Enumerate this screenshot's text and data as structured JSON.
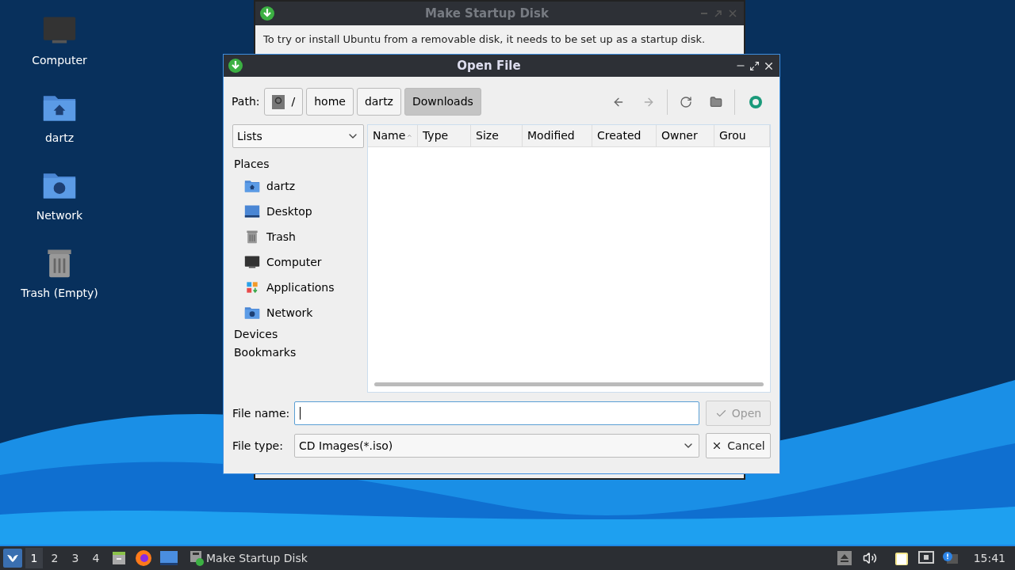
{
  "desktop_icons": [
    {
      "label": "Computer",
      "kind": "computer"
    },
    {
      "label": "dartz",
      "kind": "home"
    },
    {
      "label": "Network",
      "kind": "network"
    },
    {
      "label": "Trash (Empty)",
      "kind": "trash"
    }
  ],
  "background_window": {
    "title": "Make Startup Disk",
    "text": "To try or install Ubuntu from a removable disk, it needs to be set up as a startup disk."
  },
  "dialog": {
    "title": "Open File",
    "path_label": "Path:",
    "path_buttons": [
      {
        "label": "/",
        "kind": "root",
        "selected": false
      },
      {
        "label": "home",
        "kind": "dir",
        "selected": false
      },
      {
        "label": "dartz",
        "kind": "dir",
        "selected": false
      },
      {
        "label": "Downloads",
        "kind": "dir",
        "selected": true
      }
    ],
    "view_select": "Lists",
    "sections": [
      {
        "label": "Places",
        "items": [
          {
            "label": "dartz",
            "kind": "home"
          },
          {
            "label": "Desktop",
            "kind": "desktop"
          },
          {
            "label": "Trash",
            "kind": "trash"
          },
          {
            "label": "Computer",
            "kind": "computer"
          },
          {
            "label": "Applications",
            "kind": "apps"
          },
          {
            "label": "Network",
            "kind": "network"
          }
        ]
      },
      {
        "label": "Devices"
      },
      {
        "label": "Bookmarks"
      }
    ],
    "columns": [
      {
        "label": "Name",
        "sorted": true
      },
      {
        "label": "Type",
        "sorted": false
      },
      {
        "label": "Size",
        "sorted": false
      },
      {
        "label": "Modified",
        "sorted": false
      },
      {
        "label": "Created",
        "sorted": false
      },
      {
        "label": "Owner",
        "sorted": false
      },
      {
        "label": "Grou",
        "sorted": false
      }
    ],
    "file_name_label": "File name:",
    "file_type_label": "File type:",
    "file_type_value": "CD Images(*.iso)",
    "buttons": [
      {
        "label": "Open",
        "kind": "open",
        "disabled": true
      },
      {
        "label": "Cancel",
        "kind": "cancel",
        "disabled": false
      }
    ]
  },
  "taskbar": {
    "workspaces": [
      {
        "label": "1",
        "selected": true
      },
      {
        "label": "2",
        "selected": false
      },
      {
        "label": "3",
        "selected": false
      },
      {
        "label": "4",
        "selected": false
      }
    ],
    "task": "Make Startup Disk",
    "clock": "15:41"
  }
}
